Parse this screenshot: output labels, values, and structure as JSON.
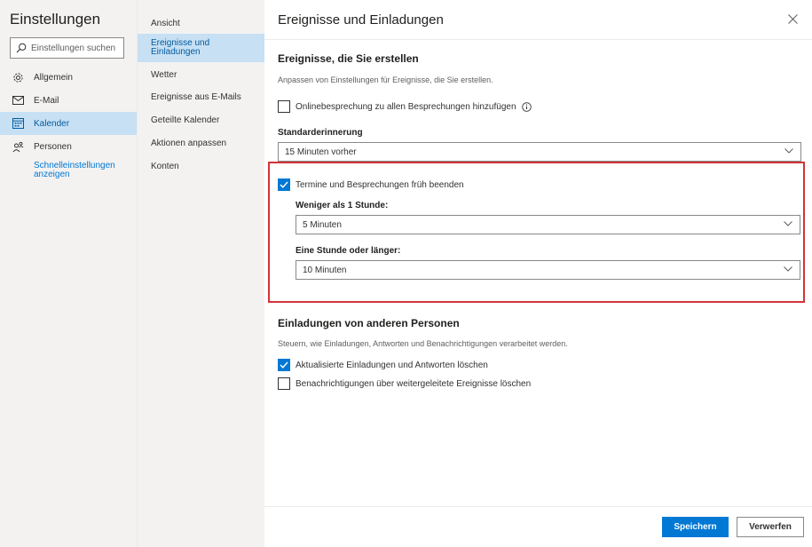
{
  "app": {
    "title": "Einstellungen"
  },
  "search": {
    "placeholder": "Einstellungen suchen"
  },
  "nav": {
    "items": [
      {
        "label": "Allgemein",
        "icon": "gear-icon"
      },
      {
        "label": "E-Mail",
        "icon": "mail-icon"
      },
      {
        "label": "Kalender",
        "icon": "calendar-icon",
        "active": true
      },
      {
        "label": "Personen",
        "icon": "people-icon"
      }
    ],
    "quick_settings": "Schnelleinstellungen anzeigen"
  },
  "subnav": {
    "items": [
      {
        "label": "Ansicht"
      },
      {
        "label": "Ereignisse und Einladungen",
        "active": true
      },
      {
        "label": "Wetter"
      },
      {
        "label": "Ereignisse aus E-Mails"
      },
      {
        "label": "Geteilte Kalender"
      },
      {
        "label": "Aktionen anpassen"
      },
      {
        "label": "Konten"
      }
    ]
  },
  "panel": {
    "title": "Ereignisse und Einladungen",
    "section1": {
      "heading": "Ereignisse, die Sie erstellen",
      "description": "Anpassen von Einstellungen für Ereignisse, die Sie erstellen.",
      "online_meeting": {
        "label": "Onlinebesprechung zu allen Besprechungen hinzufügen",
        "checked": false
      },
      "reminder": {
        "label": "Standarderinnerung",
        "value": "15 Minuten vorher"
      },
      "end_early": {
        "label": "Termine und Besprechungen früh beenden",
        "checked": true
      },
      "under_hour": {
        "label": "Weniger als 1 Stunde:",
        "value": "5 Minuten"
      },
      "hour_plus": {
        "label": "Eine Stunde oder länger:",
        "value": "10 Minuten"
      }
    },
    "section2": {
      "heading": "Einladungen von anderen Personen",
      "description": "Steuern, wie Einladungen, Antworten und Benachrichtigungen verarbeitet werden.",
      "delete_updated": {
        "label": "Aktualisierte Einladungen und Antworten löschen",
        "checked": true
      },
      "delete_forwarded": {
        "label": "Benachrichtigungen über weitergeleitete Ereignisse löschen",
        "checked": false
      }
    }
  },
  "footer": {
    "save": "Speichern",
    "discard": "Verwerfen"
  },
  "colors": {
    "accent": "#0078d4",
    "selected_bg": "#c7e0f4",
    "highlight": "#d13438",
    "sidebar_bg": "#f3f2f1"
  }
}
